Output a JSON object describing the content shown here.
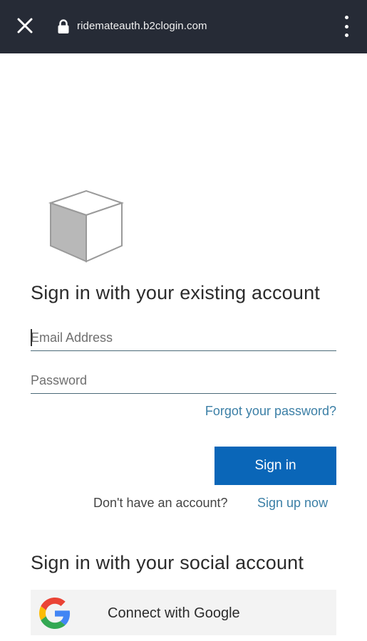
{
  "browser": {
    "url": "ridemateauth.b2clogin.com",
    "close_icon": "close-icon",
    "lock_icon": "lock-icon",
    "menu_icon": "more-vertical-icon"
  },
  "form": {
    "heading": "Sign in with your existing account",
    "email_placeholder": "Email Address",
    "password_placeholder": "Password",
    "forgot_link": "Forgot your password?",
    "signin_button": "Sign in",
    "no_account_text": "Don't have an account?",
    "signup_link": "Sign up now"
  },
  "social": {
    "heading": "Sign in with your social account",
    "google_button": "Connect with Google"
  },
  "colors": {
    "topbar": "#262b36",
    "primary": "#0a66b8",
    "link": "#3b7fa6"
  }
}
